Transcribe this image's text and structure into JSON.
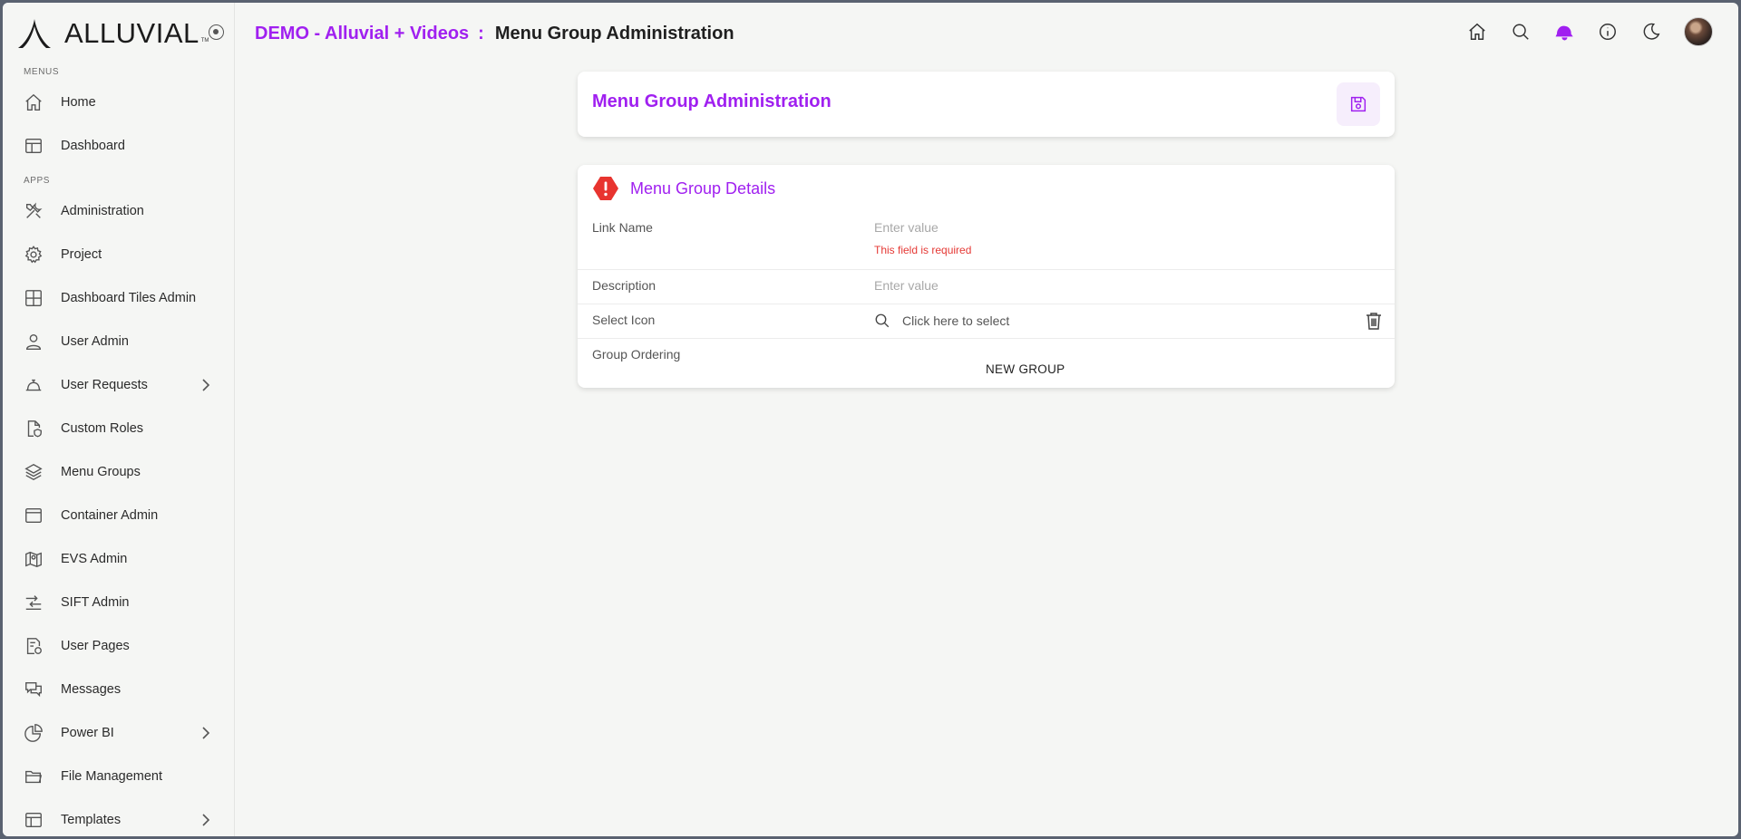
{
  "brand": {
    "name": "ALLUVIAL",
    "tm": "TM"
  },
  "sidebar": {
    "menus_label": "MENUS",
    "apps_label": "APPS",
    "menus": [
      {
        "label": "Home",
        "icon": "home-icon"
      },
      {
        "label": "Dashboard",
        "icon": "layout-icon"
      }
    ],
    "apps": [
      {
        "label": "Administration",
        "icon": "tools-icon"
      },
      {
        "label": "Project",
        "icon": "gear-icon"
      },
      {
        "label": "Dashboard Tiles Admin",
        "icon": "grid-icon"
      },
      {
        "label": "User Admin",
        "icon": "user-icon"
      },
      {
        "label": "User Requests",
        "icon": "bell-service-icon",
        "has_children": true
      },
      {
        "label": "Custom Roles",
        "icon": "document-shield-icon"
      },
      {
        "label": "Menu Groups",
        "icon": "layers-icon"
      },
      {
        "label": "Container Admin",
        "icon": "window-icon"
      },
      {
        "label": "EVS Admin",
        "icon": "map-pin-icon"
      },
      {
        "label": "SIFT Admin",
        "icon": "transfer-icon"
      },
      {
        "label": "User Pages",
        "icon": "document-info-icon"
      },
      {
        "label": "Messages",
        "icon": "chat-icon"
      },
      {
        "label": "Power BI",
        "icon": "pie-chart-icon",
        "has_children": true
      },
      {
        "label": "File Management",
        "icon": "folder-icon"
      },
      {
        "label": "Templates",
        "icon": "template-icon",
        "has_children": true
      }
    ]
  },
  "header": {
    "app_name": "DEMO - Alluvial + Videos",
    "separator": ":",
    "page_title": "Menu Group Administration"
  },
  "top_icons": [
    "home-icon",
    "search-icon",
    "notification-icon",
    "info-icon",
    "moon-icon",
    "avatar"
  ],
  "page_card": {
    "title": "Menu Group Administration",
    "save_icon": "save-icon"
  },
  "details": {
    "title": "Menu Group Details",
    "link_name": {
      "label": "Link Name",
      "placeholder": "Enter value",
      "error": "This field is required"
    },
    "description": {
      "label": "Description",
      "placeholder": "Enter value"
    },
    "select_icon": {
      "label": "Select Icon",
      "prompt": "Click here to select"
    },
    "group_ordering": {
      "label": "Group Ordering",
      "value": "NEW GROUP"
    }
  },
  "colors": {
    "accent": "#a020f0",
    "error": "#e53935",
    "alert": "#e8342f"
  }
}
